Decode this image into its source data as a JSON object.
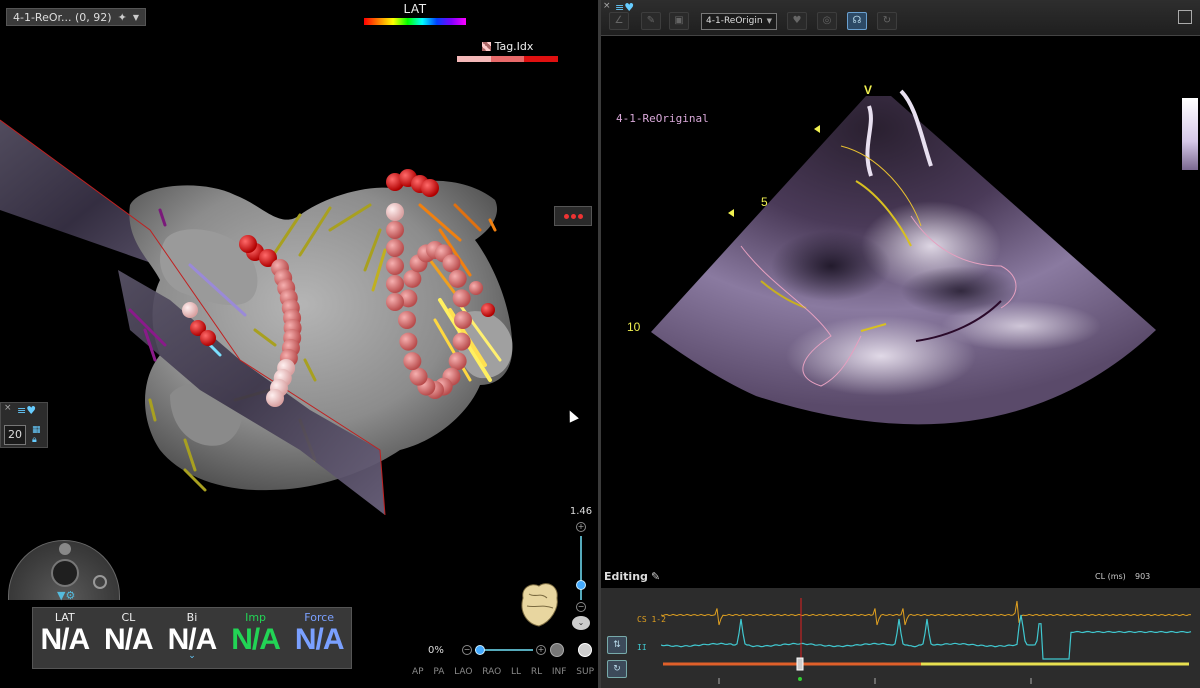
{
  "left": {
    "title": "4-1-ReOr... (0, 92)",
    "lat_legend": "LAT",
    "tag_legend": {
      "label": "Tag.Idx",
      "colors": [
        "#f4b8b8",
        "#e86a6a",
        "#e01010"
      ]
    },
    "mini_panel_value": "20",
    "readouts": [
      {
        "label": "LAT",
        "value": "N/A",
        "color": "#ffffff"
      },
      {
        "label": "CL",
        "value": "N/A",
        "color": "#ffffff"
      },
      {
        "label": "Bi",
        "value": "N/A",
        "color": "#ffffff"
      },
      {
        "label": "Imp",
        "value": "N/A",
        "color": "#22d455"
      },
      {
        "label": "Force",
        "value": "N/A",
        "color": "#7aa0ff"
      }
    ],
    "zoom_value": "1.46",
    "opacity_value": "0%",
    "view_buttons": [
      "AP",
      "PA",
      "LAO",
      "RAO",
      "LL",
      "RL",
      "INF",
      "SUP"
    ]
  },
  "right": {
    "dropdown_value": "4-1-ReOrigin",
    "echo_label": "4-1-ReOriginal",
    "depth_markers": [
      {
        "label": "V"
      },
      {
        "label": "5"
      },
      {
        "label": "10"
      }
    ],
    "editing_label": "Editing",
    "cl_label": "CL (ms)",
    "cl_value": "903",
    "channels": {
      "cs": "CS 1-2",
      "ii": "II"
    }
  },
  "colors": {
    "accent": "#4aaaff",
    "lat_tag": "#e01010",
    "cs_trace": "#e0a020",
    "ii_trace": "#40c8d0"
  }
}
